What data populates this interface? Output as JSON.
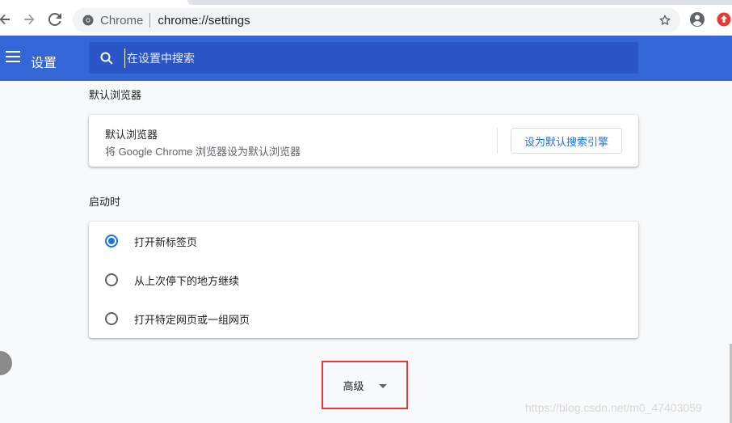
{
  "browser": {
    "omnibox": {
      "host": "Chrome",
      "url": "chrome://settings"
    }
  },
  "header": {
    "title": "设置",
    "search_placeholder": "在设置中搜索"
  },
  "default_browser": {
    "section_title": "默认浏览器",
    "item_title": "默认浏览器",
    "item_subtitle": "将 Google Chrome 浏览器设为默认浏览器",
    "button_label": "设为默认搜索引擎"
  },
  "on_startup": {
    "section_title": "启动时",
    "options": [
      {
        "label": "打开新标签页",
        "selected": true
      },
      {
        "label": "从上次停下的地方继续",
        "selected": false
      },
      {
        "label": "打开特定网页或一组网页",
        "selected": false
      }
    ]
  },
  "advanced": {
    "label": "高级"
  },
  "watermark": "https://blog.csdn.net/m0_47403059",
  "colors": {
    "header": "#3367d6",
    "search": "#2a56c6",
    "accent": "#1a73e8",
    "highlight_box": "#e53935"
  }
}
